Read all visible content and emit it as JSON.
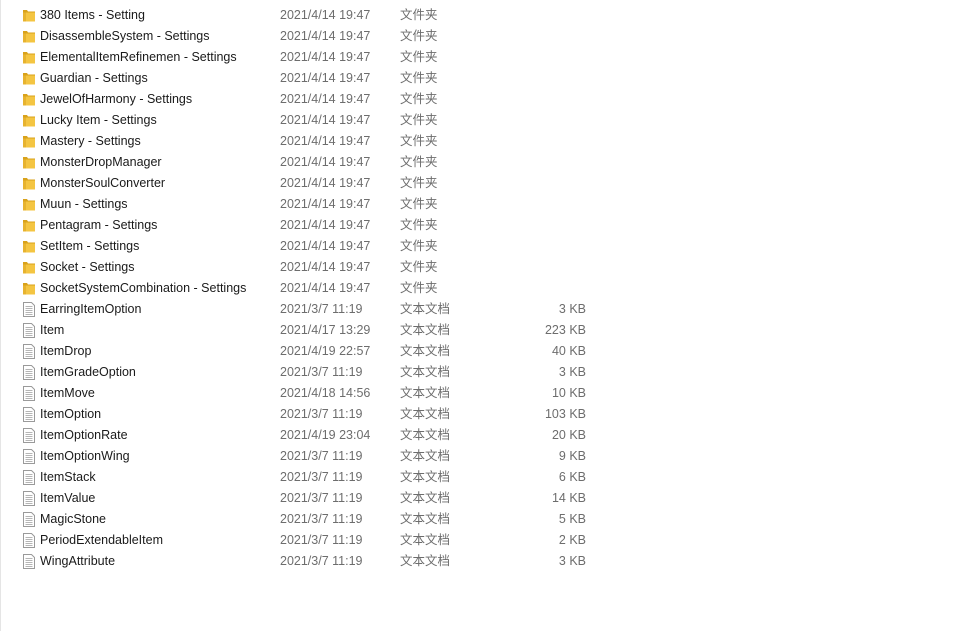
{
  "files": [
    {
      "name": "380 Items - Setting",
      "date": "2021/4/14 19:47",
      "type": "文件夹",
      "size": "",
      "icon": "folder-icon"
    },
    {
      "name": "DisassembleSystem - Settings",
      "date": "2021/4/14 19:47",
      "type": "文件夹",
      "size": "",
      "icon": "folder-icon"
    },
    {
      "name": "ElementalItemRefinemen - Settings",
      "date": "2021/4/14 19:47",
      "type": "文件夹",
      "size": "",
      "icon": "folder-icon"
    },
    {
      "name": "Guardian - Settings",
      "date": "2021/4/14 19:47",
      "type": "文件夹",
      "size": "",
      "icon": "folder-icon"
    },
    {
      "name": "JewelOfHarmony - Settings",
      "date": "2021/4/14 19:47",
      "type": "文件夹",
      "size": "",
      "icon": "folder-icon"
    },
    {
      "name": "Lucky Item - Settings",
      "date": "2021/4/14 19:47",
      "type": "文件夹",
      "size": "",
      "icon": "folder-icon"
    },
    {
      "name": "Mastery - Settings",
      "date": "2021/4/14 19:47",
      "type": "文件夹",
      "size": "",
      "icon": "folder-icon"
    },
    {
      "name": "MonsterDropManager",
      "date": "2021/4/14 19:47",
      "type": "文件夹",
      "size": "",
      "icon": "folder-icon"
    },
    {
      "name": "MonsterSoulConverter",
      "date": "2021/4/14 19:47",
      "type": "文件夹",
      "size": "",
      "icon": "folder-icon"
    },
    {
      "name": "Muun - Settings",
      "date": "2021/4/14 19:47",
      "type": "文件夹",
      "size": "",
      "icon": "folder-icon"
    },
    {
      "name": "Pentagram - Settings",
      "date": "2021/4/14 19:47",
      "type": "文件夹",
      "size": "",
      "icon": "folder-icon"
    },
    {
      "name": "SetItem - Settings",
      "date": "2021/4/14 19:47",
      "type": "文件夹",
      "size": "",
      "icon": "folder-icon"
    },
    {
      "name": "Socket - Settings",
      "date": "2021/4/14 19:47",
      "type": "文件夹",
      "size": "",
      "icon": "folder-icon"
    },
    {
      "name": "SocketSystemCombination - Settings",
      "date": "2021/4/14 19:47",
      "type": "文件夹",
      "size": "",
      "icon": "folder-icon"
    },
    {
      "name": "EarringItemOption",
      "date": "2021/3/7 11:19",
      "type": "文本文档",
      "size": "3 KB",
      "icon": "text-file-icon"
    },
    {
      "name": "Item",
      "date": "2021/4/17 13:29",
      "type": "文本文档",
      "size": "223 KB",
      "icon": "text-file-icon"
    },
    {
      "name": "ItemDrop",
      "date": "2021/4/19 22:57",
      "type": "文本文档",
      "size": "40 KB",
      "icon": "text-file-icon"
    },
    {
      "name": "ItemGradeOption",
      "date": "2021/3/7 11:19",
      "type": "文本文档",
      "size": "3 KB",
      "icon": "text-file-icon"
    },
    {
      "name": "ItemMove",
      "date": "2021/4/18 14:56",
      "type": "文本文档",
      "size": "10 KB",
      "icon": "text-file-icon"
    },
    {
      "name": "ItemOption",
      "date": "2021/3/7 11:19",
      "type": "文本文档",
      "size": "103 KB",
      "icon": "text-file-icon"
    },
    {
      "name": "ItemOptionRate",
      "date": "2021/4/19 23:04",
      "type": "文本文档",
      "size": "20 KB",
      "icon": "text-file-icon"
    },
    {
      "name": "ItemOptionWing",
      "date": "2021/3/7 11:19",
      "type": "文本文档",
      "size": "9 KB",
      "icon": "text-file-icon"
    },
    {
      "name": "ItemStack",
      "date": "2021/3/7 11:19",
      "type": "文本文档",
      "size": "6 KB",
      "icon": "text-file-icon"
    },
    {
      "name": "ItemValue",
      "date": "2021/3/7 11:19",
      "type": "文本文档",
      "size": "14 KB",
      "icon": "text-file-icon"
    },
    {
      "name": "MagicStone",
      "date": "2021/3/7 11:19",
      "type": "文本文档",
      "size": "5 KB",
      "icon": "text-file-icon"
    },
    {
      "name": "PeriodExtendableItem",
      "date": "2021/3/7 11:19",
      "type": "文本文档",
      "size": "2 KB",
      "icon": "text-file-icon"
    },
    {
      "name": "WingAttribute",
      "date": "2021/3/7 11:19",
      "type": "文本文档",
      "size": "3 KB",
      "icon": "text-file-icon"
    }
  ],
  "colors": {
    "folder": "#f4c542",
    "folder_dark": "#d9a21b",
    "file_line": "#9a9a9a"
  }
}
